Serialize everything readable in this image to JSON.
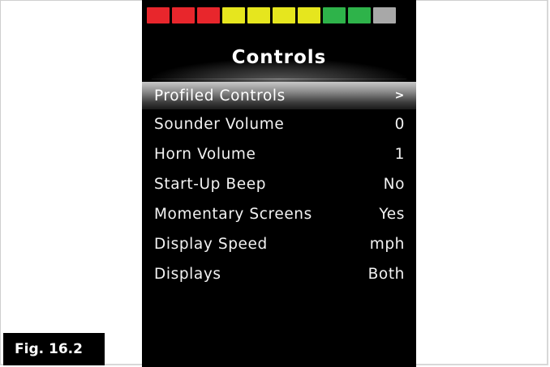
{
  "screen": {
    "title": "Controls",
    "battery_segments": [
      {
        "color": "#e8262c"
      },
      {
        "color": "#e8262c"
      },
      {
        "color": "#e8262c"
      },
      {
        "color": "#e6e61e"
      },
      {
        "color": "#e6e61e"
      },
      {
        "color": "#e6e61e"
      },
      {
        "color": "#e6e61e"
      },
      {
        "color": "#2eb34a"
      },
      {
        "color": "#2eb34a"
      },
      {
        "color": "#a8a8a8"
      }
    ],
    "menu_items": [
      {
        "label": "Profiled Controls",
        "value": ">",
        "selected": true
      },
      {
        "label": "Sounder Volume",
        "value": "0"
      },
      {
        "label": "Horn Volume",
        "value": "1"
      },
      {
        "label": "Start-Up Beep",
        "value": "No"
      },
      {
        "label": "Momentary Screens",
        "value": "Yes"
      },
      {
        "label": "Display Speed",
        "value": "mph"
      },
      {
        "label": "Displays",
        "value": "Both"
      }
    ]
  },
  "figure": {
    "label": "Fig. 16.2"
  }
}
